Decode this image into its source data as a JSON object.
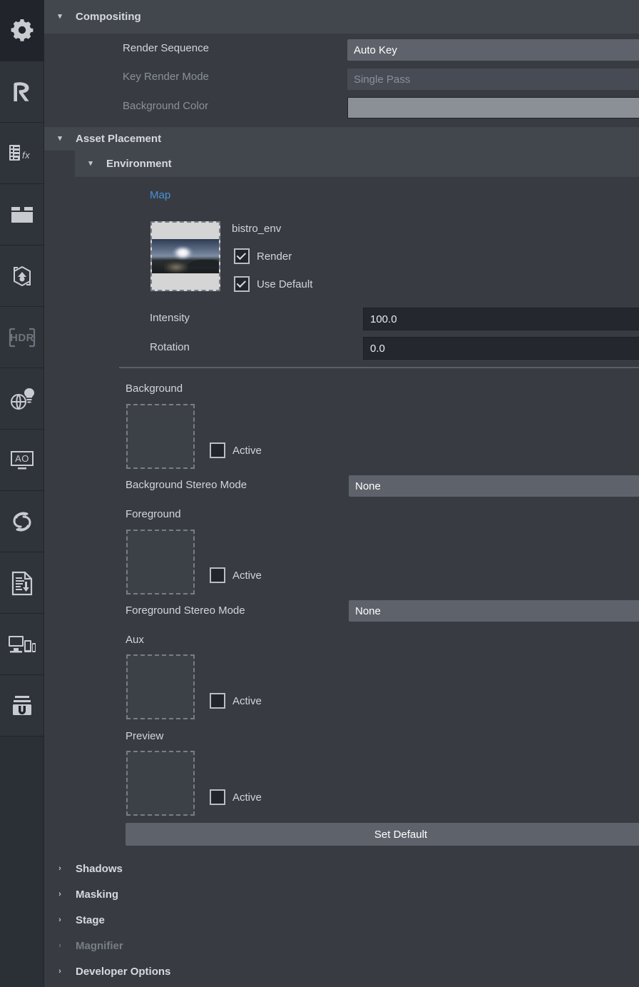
{
  "rail": {
    "items": [
      {
        "name": "settings-gear",
        "label": "Settings",
        "selected": true,
        "disabled": false
      },
      {
        "name": "render-r",
        "label": "Render",
        "selected": false,
        "disabled": false
      },
      {
        "name": "effects-fx",
        "label": "Effects",
        "selected": false,
        "disabled": false
      },
      {
        "name": "filmstrip",
        "label": "Media",
        "selected": false,
        "disabled": false
      },
      {
        "name": "capture-cube",
        "label": "Capture",
        "selected": false,
        "disabled": false
      },
      {
        "name": "hdr",
        "label": "HDR",
        "selected": false,
        "disabled": true
      },
      {
        "name": "globe-light",
        "label": "Lighting",
        "selected": false,
        "disabled": false
      },
      {
        "name": "ao",
        "label": "AO",
        "selected": false,
        "disabled": false
      },
      {
        "name": "swirl",
        "label": "Swirl",
        "selected": false,
        "disabled": false
      },
      {
        "name": "doc-download",
        "label": "Export",
        "selected": false,
        "disabled": false
      },
      {
        "name": "devices",
        "label": "Devices",
        "selected": false,
        "disabled": false
      },
      {
        "name": "magnet-u",
        "label": "Snap",
        "selected": false,
        "disabled": false
      }
    ]
  },
  "compositing": {
    "title": "Compositing",
    "render_sequence": {
      "label": "Render Sequence",
      "value": "Auto Key"
    },
    "key_render_mode": {
      "label": "Key Render Mode",
      "value": "Single Pass"
    },
    "background_color": {
      "label": "Background Color",
      "value": "#8b8f96"
    }
  },
  "asset_placement": {
    "title": "Asset Placement",
    "environment": {
      "title": "Environment",
      "map_link": "Map",
      "map_name": "bistro_env",
      "render_checkbox": {
        "label": "Render",
        "checked": true
      },
      "use_default_checkbox": {
        "label": "Use Default",
        "checked": true
      },
      "intensity": {
        "label": "Intensity",
        "value": "100.0"
      },
      "rotation": {
        "label": "Rotation",
        "value": "0.0"
      }
    },
    "slots": [
      {
        "caption": "Background",
        "active": {
          "label": "Active",
          "checked": false
        },
        "stereo": {
          "label": "Background Stereo Mode",
          "value": "None"
        }
      },
      {
        "caption": "Foreground",
        "active": {
          "label": "Active",
          "checked": false
        },
        "stereo": {
          "label": "Foreground Stereo Mode",
          "value": "None"
        }
      },
      {
        "caption": "Aux",
        "active": {
          "label": "Active",
          "checked": false
        },
        "stereo": null
      },
      {
        "caption": "Preview",
        "active": {
          "label": "Active",
          "checked": false
        },
        "stereo": null
      }
    ],
    "set_default_button": "Set Default"
  },
  "collapsed_sections": [
    {
      "title": "Shadows",
      "disabled": false
    },
    {
      "title": "Masking",
      "disabled": false
    },
    {
      "title": "Stage",
      "disabled": false
    },
    {
      "title": "Magnifier",
      "disabled": true
    },
    {
      "title": "Developer Options",
      "disabled": false
    }
  ],
  "colors": {
    "panel_bg": "#383c42",
    "header_bg": "#42464d",
    "rail_bg": "#2f333a",
    "link_blue": "#4a90d9",
    "text": "#d2d5da",
    "text_dim": "#8b9098",
    "combo_bg": "#5e636b",
    "field_bg": "#24282e"
  },
  "icons": {
    "chevron_down": "⌄",
    "chevron_right": "›"
  }
}
